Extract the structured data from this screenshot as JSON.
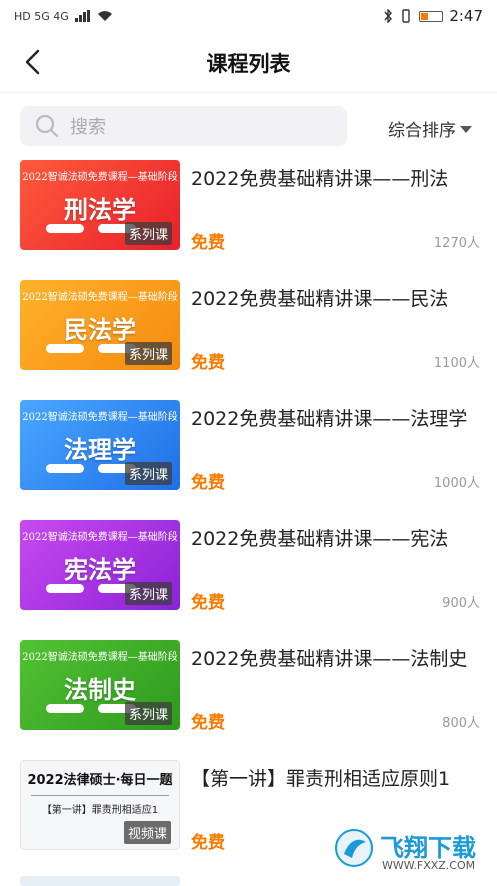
{
  "status_bar": {
    "left": "HD  5G 4G",
    "time": "2:47"
  },
  "header": {
    "title": "课程列表"
  },
  "search": {
    "placeholder": "搜索"
  },
  "sort": {
    "label": "综合排序"
  },
  "thumb_banner": "2022智诚法硕免费课程—基础阶段",
  "courses": [
    {
      "title": "2022免费基础精讲课——刑法",
      "subject": "刑法学",
      "tag": "系列课",
      "price": "免费",
      "count": "1270人",
      "color_a": "#ff5a3c",
      "color_b": "#e8202a"
    },
    {
      "title": "2022免费基础精讲课——民法",
      "subject": "民法学",
      "tag": "系列课",
      "price": "免费",
      "count": "1100人",
      "color_a": "#ffb22a",
      "color_b": "#f58a10"
    },
    {
      "title": "2022免费基础精讲课——法理学",
      "subject": "法理学",
      "tag": "系列课",
      "price": "免费",
      "count": "1000人",
      "color_a": "#4aa8ff",
      "color_b": "#1e6fe6"
    },
    {
      "title": "2022免费基础精讲课——宪法",
      "subject": "宪法学",
      "tag": "系列课",
      "price": "免费",
      "count": "900人",
      "color_a": "#c84af0",
      "color_b": "#8a22d6"
    },
    {
      "title": "2022免费基础精讲课——法制史",
      "subject": "法制史",
      "tag": "系列课",
      "price": "免费",
      "count": "800人",
      "color_a": "#52c234",
      "color_b": "#2e9a1e"
    },
    {
      "title": "【第一讲】罪责刑相适应原则1",
      "thumb_title": "2022法律硕士·每日一题",
      "thumb_sub": "【第一讲】罪责刑相适应1",
      "tag": "视频课",
      "price": "免费",
      "count": ""
    }
  ],
  "watermark": {
    "text": "飞翔下载",
    "url": "WWW.FXXZ.COM"
  },
  "colors": {
    "accent": "#f57c00"
  }
}
